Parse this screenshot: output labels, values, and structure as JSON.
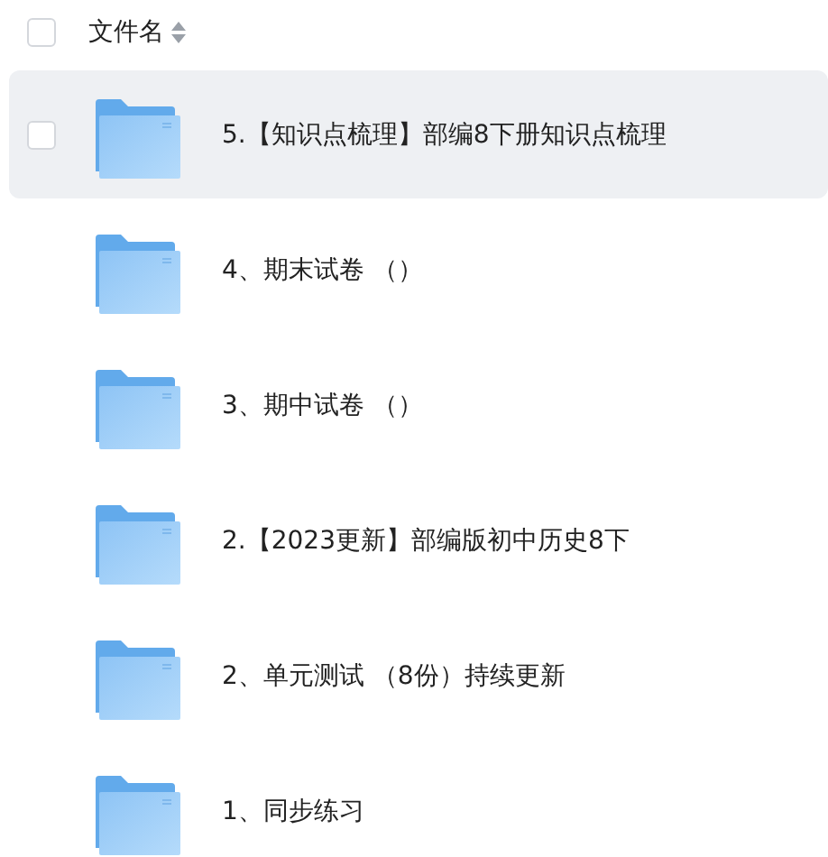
{
  "header": {
    "column_label": "文件名",
    "select_all_checked": false
  },
  "rows": [
    {
      "name": "5.【知识点梳理】部编8下册知识点梳理",
      "hovered": true,
      "checked": false
    },
    {
      "name": "4、期末试卷 （）",
      "hovered": false,
      "checked": false
    },
    {
      "name": "3、期中试卷 （）",
      "hovered": false,
      "checked": false
    },
    {
      "name": "2.【2023更新】部编版初中历史8下",
      "hovered": false,
      "checked": false
    },
    {
      "name": "2、单元测试 （8份）持续更新",
      "hovered": false,
      "checked": false
    },
    {
      "name": "1、同步练习",
      "hovered": false,
      "checked": false
    }
  ]
}
